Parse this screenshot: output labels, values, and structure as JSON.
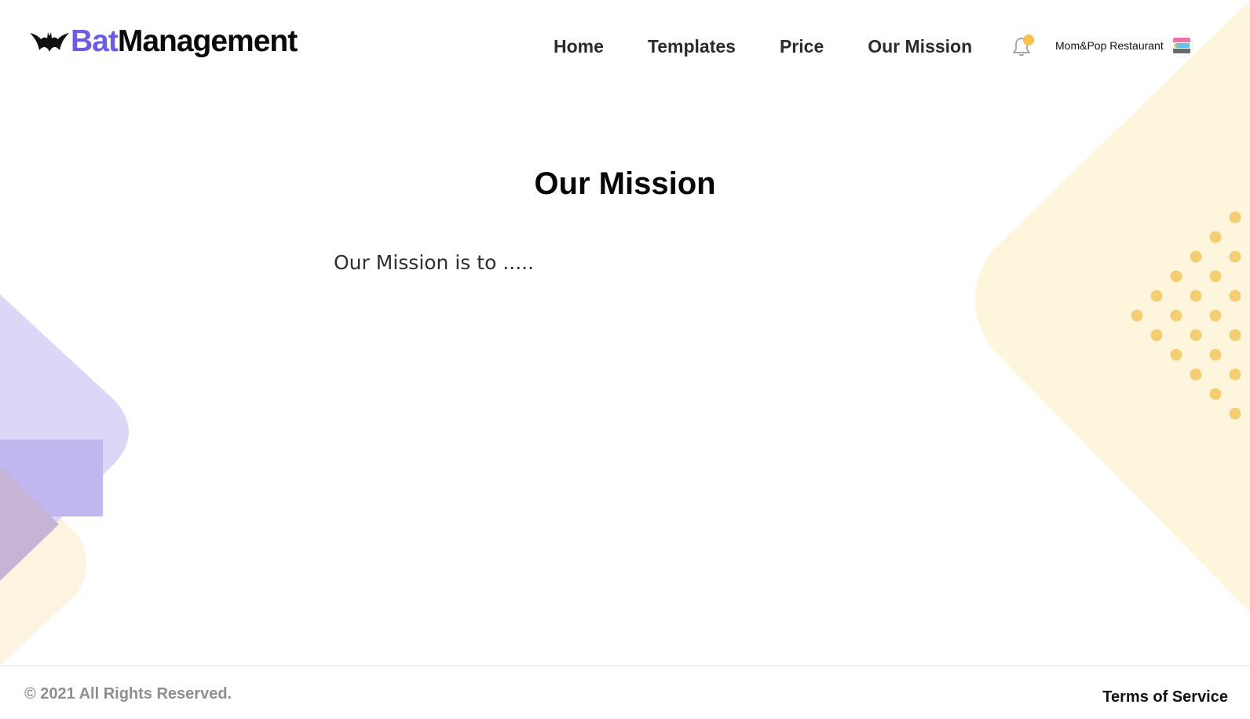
{
  "brand": {
    "logo_part_1": "Bat",
    "logo_part_2": "Management",
    "accent_color": "#6c5ce7",
    "logo_icon": "bat-icon"
  },
  "nav": {
    "items": [
      {
        "label": "Home"
      },
      {
        "label": "Templates"
      },
      {
        "label": "Price"
      },
      {
        "label": "Our Mission"
      }
    ]
  },
  "notifications": {
    "icon": "bell-icon",
    "badge_color": "#f4c150"
  },
  "account": {
    "name": "Mom&Pop Restaurant",
    "avatar_icon": "mom-pop-shop-logo"
  },
  "main": {
    "title": "Our Mission",
    "body": "Our Mission is to ....."
  },
  "footer": {
    "copyright": "© 2021 All Rights Reserved.",
    "terms_label": "Terms of Service"
  },
  "colors": {
    "decor_yellow": "#fdf5dc",
    "decor_dots": "#f5cd73",
    "decor_lavender": "#dcd7f6",
    "decor_purple": "#c0b7ee"
  }
}
